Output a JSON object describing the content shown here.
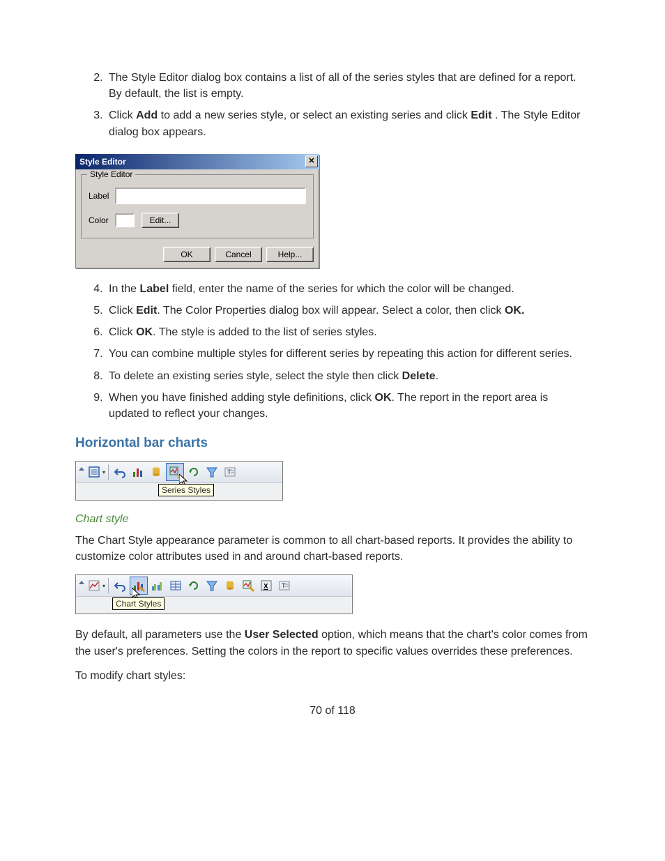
{
  "steps_a": [
    {
      "n": "2",
      "parts": [
        "The Style Editor dialog box contains a list of all of the series styles that are defined for a report. By default, the list is empty."
      ]
    },
    {
      "n": "3",
      "parts": [
        "Click ",
        "Add",
        " to add a new series style, or select an existing series and click ",
        "Edit",
        " . The Style Editor dialog box appears."
      ]
    }
  ],
  "steps_b": [
    {
      "n": "4",
      "parts": [
        "In the ",
        "Label",
        " field, enter the name of the series for which the color will be changed."
      ]
    },
    {
      "n": "5",
      "parts": [
        "Click ",
        "Edit",
        ". The Color Properties dialog box will appear. Select a color, then click ",
        "OK."
      ]
    },
    {
      "n": "6",
      "parts": [
        "Click ",
        "OK",
        ". The style is added to the list of series styles."
      ]
    },
    {
      "n": "7",
      "parts": [
        "You can combine multiple styles for different series by repeating this action for different series."
      ]
    },
    {
      "n": "8",
      "parts": [
        "To delete an existing series style, select the style then click ",
        "Delete",
        "."
      ]
    },
    {
      "n": "9",
      "parts": [
        "When you have finished adding style definitions, click ",
        "OK",
        ". The report in the report area is updated to reflect your changes."
      ]
    }
  ],
  "dialog": {
    "title": "Style Editor",
    "group_title": "Style Editor",
    "label_label": "Label",
    "color_label": "Color",
    "edit_btn": "Edit...",
    "ok_btn": "OK",
    "cancel_btn": "Cancel",
    "help_btn": "Help..."
  },
  "section_h": "Horizontal bar charts",
  "sub_h": "Chart style",
  "para1": "The Chart Style appearance parameter is common to all chart-based reports. It provides the ability to customize color attributes used in and around chart-based reports.",
  "para2": {
    "pre": "By default, all parameters use the ",
    "bold": "User Selected",
    "post": " option, which means that the chart's color comes from the user's preferences. Setting the colors in the report to specific values overrides these preferences."
  },
  "para3": "To modify chart styles:",
  "toolbar1": {
    "tooltip": "Series Styles"
  },
  "toolbar2": {
    "tooltip": "Chart Styles"
  },
  "page_number": "70 of 118"
}
